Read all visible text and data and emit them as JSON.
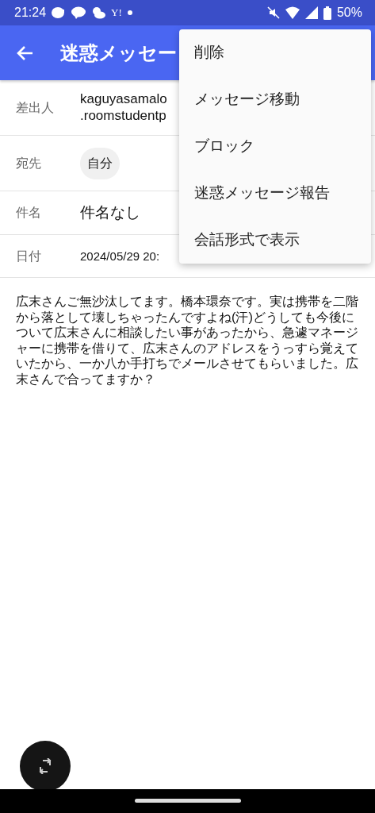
{
  "status_bar": {
    "time": "21:24",
    "app_badge": "Y!",
    "battery": "50%"
  },
  "app_bar": {
    "title": "迷惑メッセー"
  },
  "headers": [
    {
      "label": "差出人",
      "kind": "lines",
      "lines": [
        "kaguyasamalo",
        ".roomstudentp"
      ]
    },
    {
      "label": "宛先",
      "kind": "chip",
      "lines": [
        "自分"
      ]
    },
    {
      "label": "件名",
      "kind": "large",
      "lines": [
        "件名なし"
      ]
    },
    {
      "label": "日付",
      "kind": "small",
      "lines": [
        "2024/05/29 20:"
      ]
    }
  ],
  "body": "広末さんご無沙汰してます。橋本環奈です。実は携帯を二階から落として壊しちゃったんですよね(汗)どうしても今後について広末さんに相談したい事があったから、急遽マネージャーに携帯を借りて、広末さんのアドレスをうっすら覚えていたから、一か八か手打ちでメールさせてもらいました。広末さんで合ってますか？",
  "menu": [
    "削除",
    "メッセージ移動",
    "ブロック",
    "迷惑メッセージ報告",
    "会話形式で表示"
  ]
}
